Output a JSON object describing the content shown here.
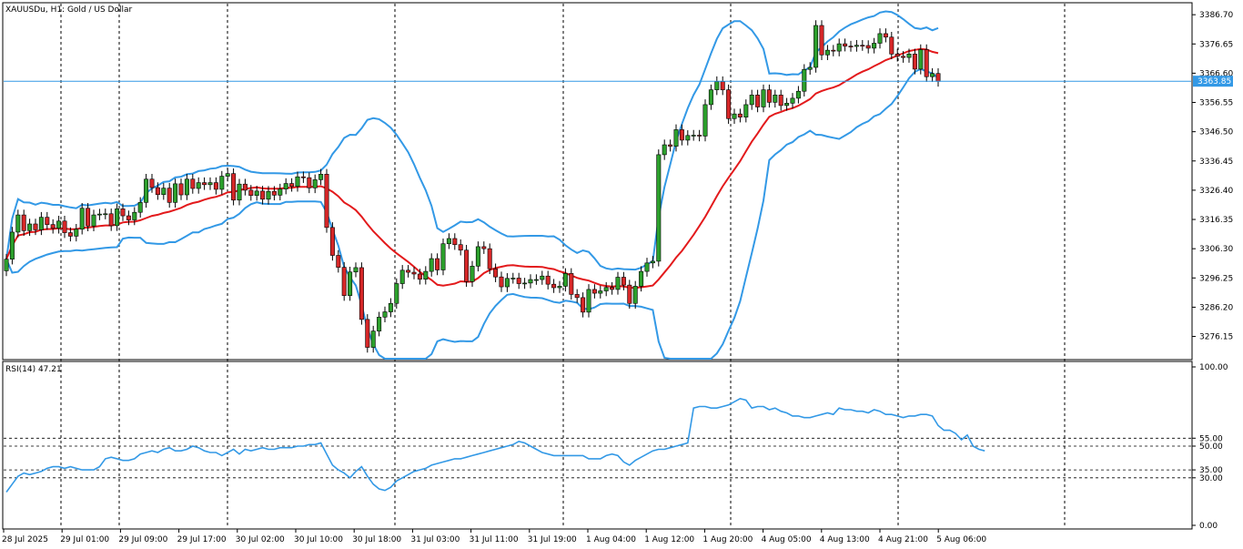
{
  "header": {
    "symbol_title": "XAUUSDu, H1:  Gold / US Dollar"
  },
  "rsi_header": "RSI(14) 47.21",
  "current_price_label": "3363.85",
  "colors": {
    "bull_candle": "#2ca02c",
    "bear_candle": "#d62728",
    "bollinger": "#3399e6",
    "middle_band": "#e31a1c",
    "rsi_line": "#3399e6",
    "price_line": "#3399e6"
  },
  "chart_data": [
    {
      "type": "candlestick",
      "title": "XAUUSDu, H1:  Gold / US Dollar",
      "x_tick_labels": [
        "28 Jul 2025",
        "29 Jul 01:00",
        "29 Jul 09:00",
        "29 Jul 17:00",
        "30 Jul 02:00",
        "30 Jul 10:00",
        "30 Jul 18:00",
        "31 Jul 03:00",
        "31 Jul 11:00",
        "31 Jul 19:00",
        "1 Aug 04:00",
        "1 Aug 12:00",
        "1 Aug 20:00",
        "4 Aug 05:00",
        "4 Aug 13:00",
        "4 Aug 21:00",
        "5 Aug 06:00"
      ],
      "y_tick_labels": [
        "3386.70",
        "3376.65",
        "3366.60",
        "3356.55",
        "3346.50",
        "3336.45",
        "3326.40",
        "3316.35",
        "3306.30",
        "3296.25",
        "3286.20",
        "3276.15"
      ],
      "ylim": [
        3268.5,
        3390.5
      ],
      "current_price": 3363.85,
      "closes": [
        3302.7,
        3312.0,
        3317.9,
        3312.5,
        3314.8,
        3312.8,
        3317.1,
        3314.6,
        3313.3,
        3315.8,
        3311.8,
        3310.6,
        3313.0,
        3320.2,
        3314.1,
        3317.9,
        3318.2,
        3318.3,
        3314.2,
        3320.0,
        3317.6,
        3316.2,
        3318.8,
        3322.2,
        3330.2,
        3327.3,
        3324.9,
        3327.1,
        3322.2,
        3328.6,
        3324.8,
        3330.2,
        3327.0,
        3329.0,
        3328.3,
        3329.0,
        3326.7,
        3331.2,
        3332.1,
        3323.0,
        3328.5,
        3326.4,
        3324.6,
        3326.1,
        3323.3,
        3326.0,
        3324.7,
        3326.8,
        3328.7,
        3327.7,
        3331.0,
        3330.7,
        3327.2,
        3330.0,
        3331.9,
        3313.6,
        3304.0,
        3299.9,
        3290.2,
        3298.3,
        3299.8,
        3282.0,
        3272.4,
        3278.0,
        3282.8,
        3284.6,
        3287.5,
        3294.3,
        3298.9,
        3298.2,
        3297.6,
        3295.8,
        3298.5,
        3302.9,
        3299.0,
        3308.0,
        3309.8,
        3307.7,
        3305.8,
        3295.0,
        3300.3,
        3307.0,
        3306.3,
        3299.4,
        3296.6,
        3293.2,
        3296.1,
        3296.2,
        3294.3,
        3294.5,
        3295.7,
        3295.7,
        3296.9,
        3294.1,
        3292.9,
        3293.4,
        3297.8,
        3290.6,
        3289.5,
        3284.5,
        3292.3,
        3291.0,
        3291.8,
        3293.0,
        3292.3,
        3296.5,
        3293.8,
        3287.5,
        3293.4,
        3298.5,
        3301.4,
        3302.0,
        3338.6,
        3342.0,
        3341.5,
        3347.2,
        3343.6,
        3345.2,
        3345.3,
        3345.0,
        3355.8,
        3360.9,
        3363.7,
        3360.9,
        3351.0,
        3352.6,
        3351.5,
        3355.8,
        3359.1,
        3355.0,
        3360.9,
        3356.6,
        3359.1,
        3355.5,
        3356.3,
        3358.0,
        3360.4,
        3367.9,
        3368.6,
        3383.0,
        3372.9,
        3374.5,
        3374.2,
        3376.7,
        3375.9,
        3375.8,
        3376.2,
        3376.1,
        3375.2,
        3376.9,
        3380.2,
        3379.0,
        3373.2,
        3372.4,
        3372.0,
        3373.2,
        3368.0,
        3374.7,
        3365.4,
        3366.5,
        3363.8
      ],
      "bollinger_upper_note": "upper, middle and lower Bollinger bands drawn as lines",
      "panel": "price"
    },
    {
      "type": "line",
      "title": "RSI(14) 47.21",
      "y_tick_labels": [
        "100.00",
        "55.00",
        "50.00",
        "35.00",
        "30.00",
        "0.00"
      ],
      "ylim": [
        0,
        100
      ],
      "levels": [
        55,
        50,
        35,
        30
      ],
      "values": [
        21,
        26,
        31,
        33,
        32,
        33,
        34,
        36,
        37,
        37,
        36,
        37,
        36,
        35,
        35,
        35,
        37,
        42,
        43,
        42,
        41,
        41,
        42,
        45,
        46,
        47,
        46,
        48,
        49,
        47,
        47,
        48,
        50,
        49,
        47,
        46,
        46,
        44,
        46,
        48,
        45,
        48,
        47,
        48,
        49,
        48,
        48,
        49,
        49,
        49,
        50,
        50,
        51,
        51,
        52,
        45,
        38,
        35,
        33,
        30,
        34,
        37,
        31,
        26,
        23,
        22,
        24,
        28,
        30,
        32,
        34,
        35,
        36,
        38,
        39,
        40,
        41,
        42,
        42,
        43,
        44,
        45,
        46,
        47,
        48,
        49,
        50,
        51,
        53,
        52,
        50,
        48,
        46,
        45,
        44,
        44,
        44,
        44,
        44,
        44,
        42,
        42,
        42,
        44,
        45,
        44,
        40,
        38,
        41,
        43,
        45,
        47,
        48,
        48,
        49,
        50,
        51,
        52,
        74,
        75,
        75,
        74,
        74,
        75,
        76,
        78,
        80,
        79,
        74,
        75,
        75,
        73,
        74,
        72,
        71,
        69,
        69,
        68,
        68,
        69,
        70,
        71,
        70,
        74,
        73,
        73,
        72,
        72,
        71,
        73,
        72,
        70,
        70,
        69,
        68,
        69,
        69,
        70,
        70,
        69,
        63,
        60,
        60,
        58,
        54,
        57,
        50,
        48,
        47
      ],
      "panel": "rsi"
    }
  ]
}
